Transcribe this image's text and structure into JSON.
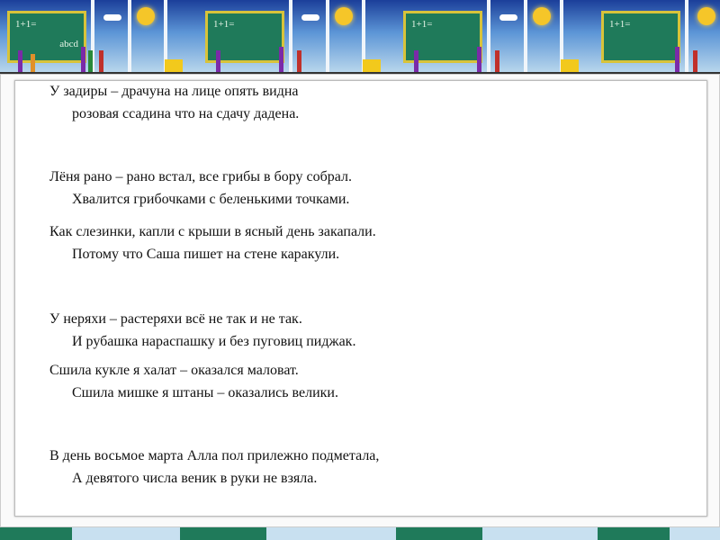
{
  "banner": {
    "board_text_1": "1+1=",
    "board_text_2": "abcd"
  },
  "stanzas": [
    [
      "У задиры – драчуна на лице опять видна",
      "розовая ссадина что на сдачу дадена."
    ],
    [
      "Лёня рано – рано встал, все грибы в бору собрал.",
      "Хвалится грибочками с беленькими точками."
    ],
    [
      "Как слезинки, капли с крыши в ясный день закапали.",
      "Потому что Саша пишет на стене каракули."
    ],
    [
      "У неряхи – растеряхи всё не так и не так.",
      "И рубашка нараспашку и без пуговиц пиджак."
    ],
    [
      "Сшила кукле я халат – оказался маловат.",
      "Сшила мишке я штаны – оказались велики."
    ],
    [
      "В день восьмое марта Алла пол прилежно подметала,",
      "А девятого числа веник в руки не взяла."
    ]
  ]
}
